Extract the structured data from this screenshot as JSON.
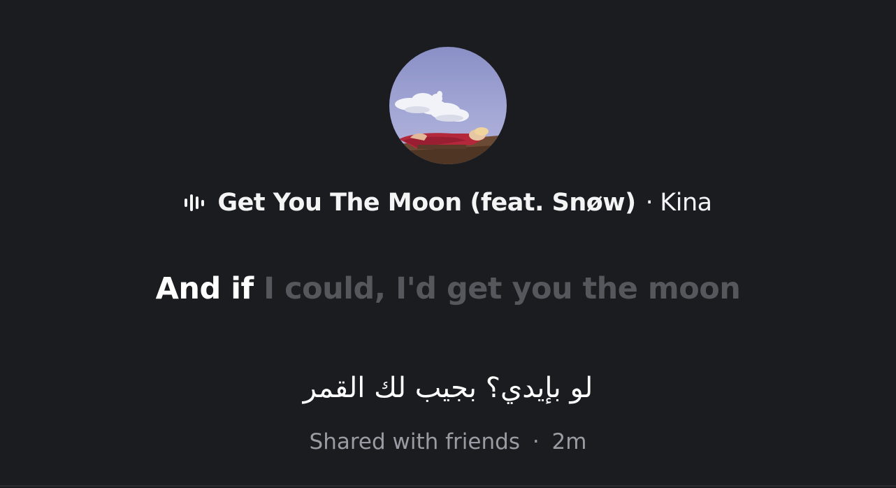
{
  "track": {
    "title": "Get You The Moon (feat. Snøw)",
    "separator": "·",
    "artist": "Kina",
    "playing_icon": "equalizer-icon"
  },
  "lyric": {
    "sung": "And if ",
    "remaining": "I could, I'd get you the moon"
  },
  "translation": "لو بإيدي؟ بجيب لك القمر",
  "footer": {
    "shared": "Shared with friends",
    "separator": "·",
    "time": "2m"
  },
  "colors": {
    "background": "#1b1c20",
    "text_primary": "#ffffff",
    "lyric_unsung": "#55575c",
    "text_secondary": "#9a9ca3"
  }
}
